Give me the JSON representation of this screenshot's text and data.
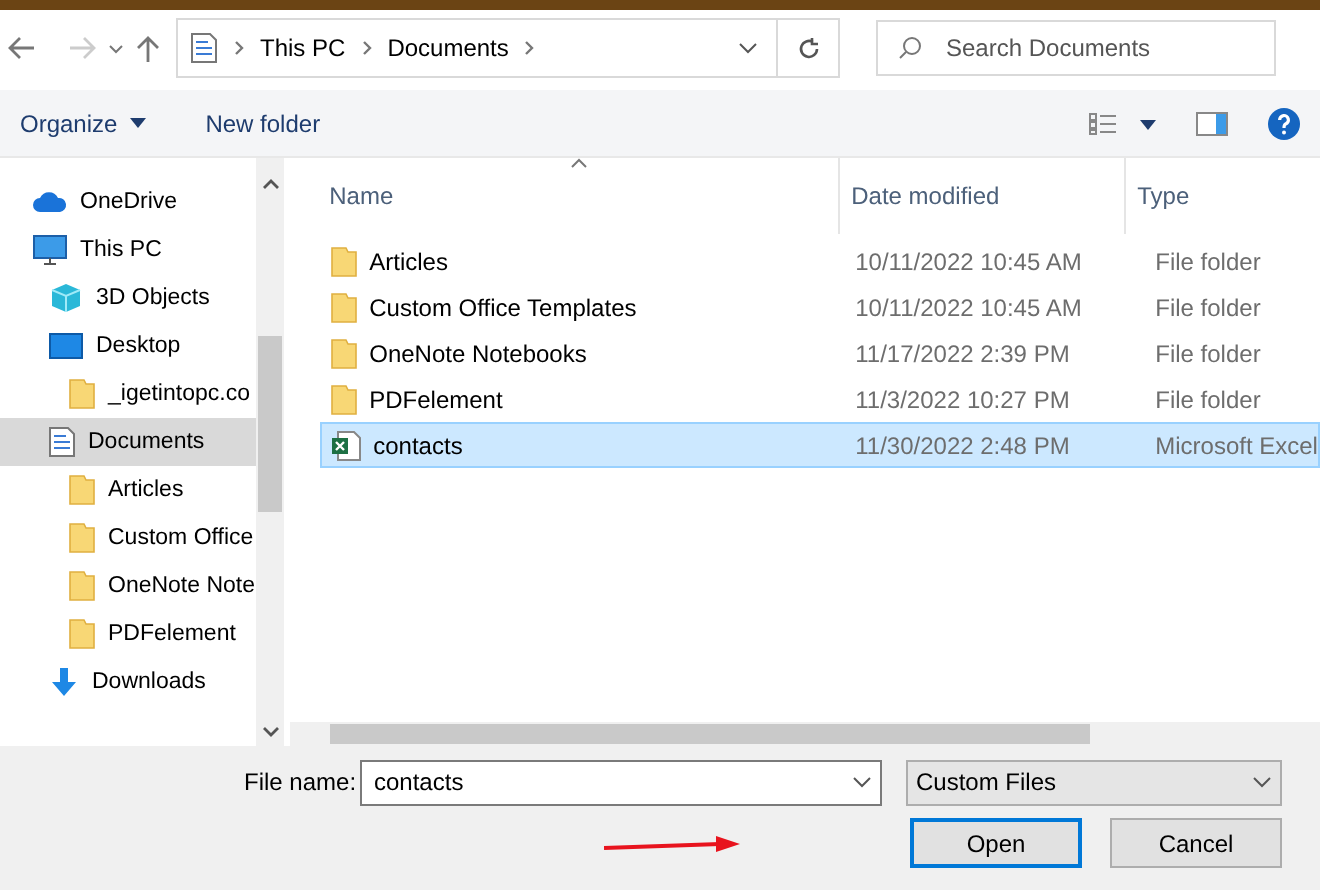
{
  "address_bar": {
    "segments": [
      "This PC",
      "Documents"
    ]
  },
  "search": {
    "placeholder": "Search Documents"
  },
  "toolbar": {
    "buttons": [
      "Organize",
      "New folder"
    ]
  },
  "sidebar": {
    "items": [
      {
        "label": "OneDrive",
        "kind": "cloud",
        "selected": false
      },
      {
        "label": "This PC",
        "kind": "pc",
        "selected": false,
        "children": [
          {
            "label": "3D Objects",
            "kind": "cube",
            "selected": false
          },
          {
            "label": "Desktop",
            "kind": "desktop",
            "selected": false,
            "children": [
              {
                "label": "_igetintopc.co",
                "kind": "folder",
                "selected": false
              }
            ]
          },
          {
            "label": "Documents",
            "kind": "document",
            "selected": true,
            "children": [
              {
                "label": "Articles",
                "kind": "folder",
                "selected": false
              },
              {
                "label": "Custom Office",
                "kind": "folder",
                "selected": false
              },
              {
                "label": "OneNote Note",
                "kind": "folder",
                "selected": false
              },
              {
                "label": "PDFelement",
                "kind": "folder",
                "selected": false
              }
            ]
          },
          {
            "label": "Downloads",
            "kind": "download",
            "selected": false
          }
        ]
      }
    ]
  },
  "table": {
    "columns": [
      "Name",
      "Date modified",
      "Type"
    ],
    "rows": [
      {
        "name": "Articles",
        "kind": "folder",
        "date": "10/11/2022 10:45 AM",
        "type": "File folder",
        "selected": false
      },
      {
        "name": "Custom Office Templates",
        "kind": "folder",
        "date": "10/11/2022 10:45 AM",
        "type": "File folder",
        "selected": false
      },
      {
        "name": "OneNote Notebooks",
        "kind": "folder",
        "date": "11/17/2022 2:39 PM",
        "type": "File folder",
        "selected": false
      },
      {
        "name": "PDFelement",
        "kind": "folder",
        "date": "11/3/2022 10:27 PM",
        "type": "File folder",
        "selected": false
      },
      {
        "name": "contacts",
        "kind": "excel",
        "date": "11/30/2022 2:48 PM",
        "type": "Microsoft Excel",
        "selected": true
      }
    ]
  },
  "footer": {
    "file_name_label": "File name:",
    "file_name": "contacts",
    "filter": "Custom Files",
    "buttons": [
      "Open",
      "Cancel"
    ]
  }
}
